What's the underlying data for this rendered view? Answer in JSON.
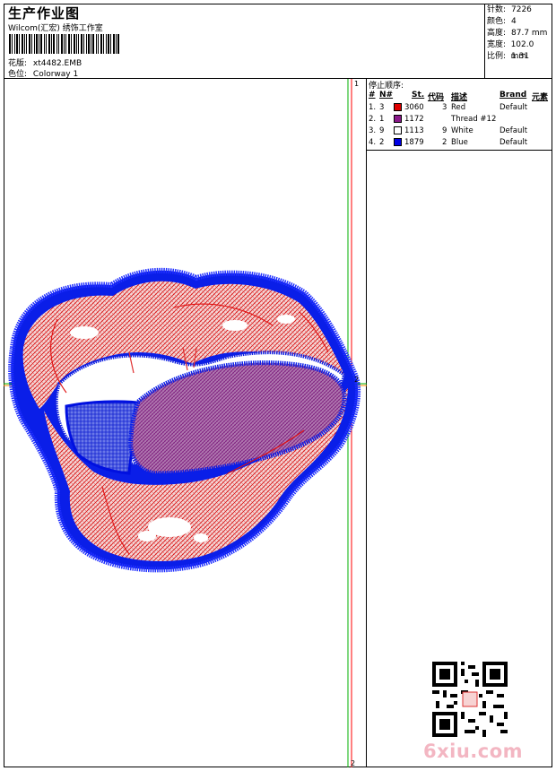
{
  "header": {
    "title": "生产作业图",
    "subtitle": "Wilcom(汇宏) 绣饰工作室",
    "design_label": "花版:",
    "design_value": "xt4482.EMB",
    "colorway_label": "色位:",
    "colorway_value": "Colorway 1"
  },
  "stats": [
    {
      "label": "针数:",
      "value": "7226"
    },
    {
      "label": "颜色:",
      "value": "4"
    },
    {
      "label": "高度:",
      "value": "87.7 mm"
    },
    {
      "label": "宽度:",
      "value": "102.0 mm"
    },
    {
      "label": "比例:",
      "value": "1.31"
    }
  ],
  "stop_sequence": {
    "title": "停止顺序:",
    "headers": {
      "hash": "#",
      "n": "N#",
      "st": "St.",
      "code": "代码",
      "desc": "描述",
      "brand": "Brand",
      "element": "元素"
    },
    "rows": [
      {
        "idx": "1.",
        "n": "3",
        "color": "#e00000",
        "st": "3060",
        "code": "3",
        "desc": "Red",
        "brand": "Default"
      },
      {
        "idx": "2.",
        "n": "1",
        "color": "#8b1a8b",
        "st": "1172",
        "code": "",
        "desc": "Thread #12",
        "brand": ""
      },
      {
        "idx": "3.",
        "n": "9",
        "color": "#ffffff",
        "st": "1113",
        "code": "9",
        "desc": "White",
        "brand": "Default"
      },
      {
        "idx": "4.",
        "n": "2",
        "color": "#0000e6",
        "st": "1879",
        "code": "2",
        "desc": "Blue",
        "brand": "Default"
      }
    ]
  },
  "markers": {
    "top": "1",
    "middle": "2",
    "bottom": "2"
  },
  "watermark": "6xiu.com",
  "colors": {
    "red": "#e00000",
    "purple": "#8b1a8b",
    "blue": "#0000e6",
    "green_guide": "#00b000",
    "red_guide": "#ff0000"
  }
}
